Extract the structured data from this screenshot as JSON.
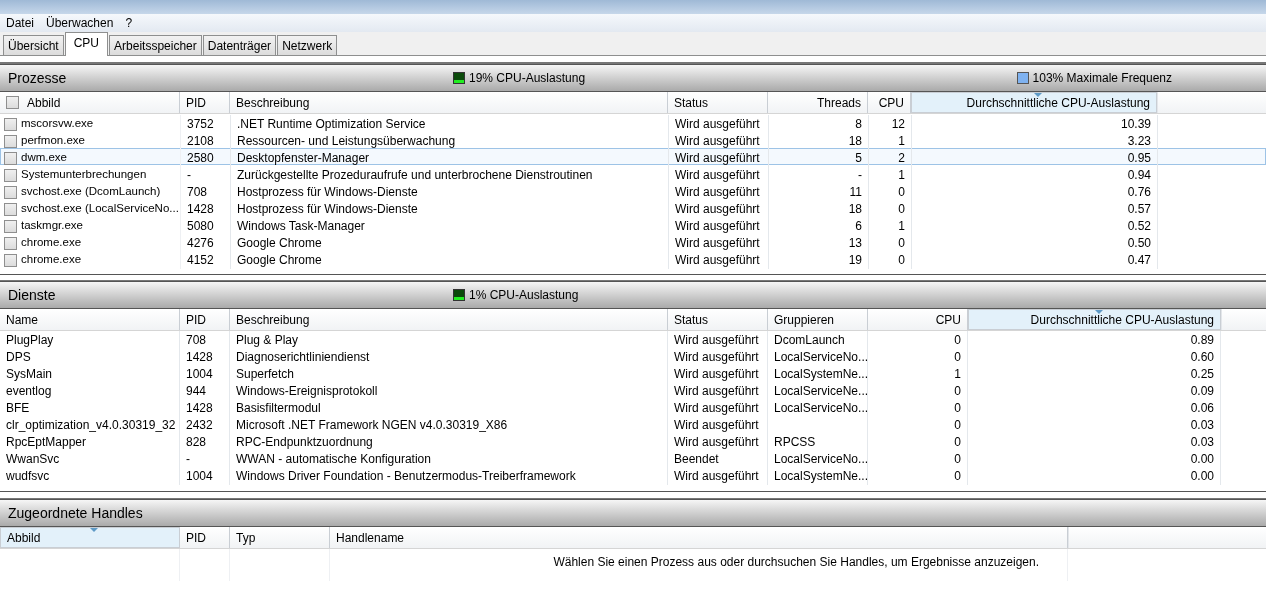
{
  "menu": [
    "Datei",
    "Überwachen",
    "?"
  ],
  "tabs": [
    {
      "label": "Übersicht",
      "selected": false
    },
    {
      "label": "CPU",
      "selected": true
    },
    {
      "label": "Arbeitsspeicher",
      "selected": false
    },
    {
      "label": "Datenträger",
      "selected": false
    },
    {
      "label": "Netzwerk",
      "selected": false
    }
  ],
  "processes": {
    "title": "Prozesse",
    "usage": "19% CPU-Auslastung",
    "frequency": "103% Maximale Frequenz",
    "header_checked": false,
    "columns": [
      {
        "label": "Abbild",
        "kind": "text",
        "sorted": false
      },
      {
        "label": "PID",
        "kind": "text",
        "sorted": false
      },
      {
        "label": "Beschreibung",
        "kind": "text",
        "sorted": false
      },
      {
        "label": "Status",
        "kind": "text",
        "sorted": false
      },
      {
        "label": "Threads",
        "kind": "number",
        "sorted": false
      },
      {
        "label": "CPU",
        "kind": "number",
        "sorted": false
      },
      {
        "label": "Durchschnittliche CPU-Auslastung",
        "kind": "number",
        "sorted": true
      }
    ],
    "rows": [
      {
        "checked": false,
        "selected": false,
        "cells": [
          "mscorsvw.exe",
          "3752",
          ".NET Runtime Optimization Service",
          "Wird ausgeführt",
          "8",
          "12",
          "10.39"
        ]
      },
      {
        "checked": false,
        "selected": false,
        "cells": [
          "perfmon.exe",
          "2108",
          "Ressourcen- und Leistungsüberwachung",
          "Wird ausgeführt",
          "18",
          "1",
          "3.23"
        ]
      },
      {
        "checked": false,
        "selected": true,
        "cells": [
          "dwm.exe",
          "2580",
          "Desktopfenster-Manager",
          "Wird ausgeführt",
          "5",
          "2",
          "0.95"
        ]
      },
      {
        "checked": false,
        "selected": false,
        "cells": [
          "Systemunterbrechungen",
          "-",
          "Zurückgestellte Prozeduraufrufe und unterbrochene Dienstroutinen",
          "Wird ausgeführt",
          "-",
          "1",
          "0.94"
        ]
      },
      {
        "checked": false,
        "selected": false,
        "cells": [
          "svchost.exe (DcomLaunch)",
          "708",
          "Hostprozess für Windows-Dienste",
          "Wird ausgeführt",
          "11",
          "0",
          "0.76"
        ]
      },
      {
        "checked": false,
        "selected": false,
        "cells": [
          "svchost.exe (LocalServiceNo...",
          "1428",
          "Hostprozess für Windows-Dienste",
          "Wird ausgeführt",
          "18",
          "0",
          "0.57"
        ]
      },
      {
        "checked": false,
        "selected": false,
        "cells": [
          "taskmgr.exe",
          "5080",
          "Windows Task-Manager",
          "Wird ausgeführt",
          "6",
          "1",
          "0.52"
        ]
      },
      {
        "checked": false,
        "selected": false,
        "cells": [
          "chrome.exe",
          "4276",
          "Google Chrome",
          "Wird ausgeführt",
          "13",
          "0",
          "0.50"
        ]
      },
      {
        "checked": false,
        "selected": false,
        "cells": [
          "chrome.exe",
          "4152",
          "Google Chrome",
          "Wird ausgeführt",
          "19",
          "0",
          "0.47"
        ]
      }
    ]
  },
  "services": {
    "title": "Dienste",
    "usage": "1% CPU-Auslastung",
    "columns": [
      {
        "label": "Name",
        "kind": "text",
        "sorted": false
      },
      {
        "label": "PID",
        "kind": "text",
        "sorted": false
      },
      {
        "label": "Beschreibung",
        "kind": "text",
        "sorted": false
      },
      {
        "label": "Status",
        "kind": "text",
        "sorted": false
      },
      {
        "label": "Gruppieren",
        "kind": "text",
        "sorted": false
      },
      {
        "label": "CPU",
        "kind": "number",
        "sorted": false
      },
      {
        "label": "Durchschnittliche CPU-Auslastung",
        "kind": "number",
        "sorted": true
      }
    ],
    "rows": [
      [
        "PlugPlay",
        "708",
        "Plug & Play",
        "Wird ausgeführt",
        "DcomLaunch",
        "0",
        "0.89"
      ],
      [
        "DPS",
        "1428",
        "Diagnoserichtliniendienst",
        "Wird ausgeführt",
        "LocalServiceNo...",
        "0",
        "0.60"
      ],
      [
        "SysMain",
        "1004",
        "Superfetch",
        "Wird ausgeführt",
        "LocalSystemNe...",
        "1",
        "0.25"
      ],
      [
        "eventlog",
        "944",
        "Windows-Ereignisprotokoll",
        "Wird ausgeführt",
        "LocalServiceNe...",
        "0",
        "0.09"
      ],
      [
        "BFE",
        "1428",
        "Basisfiltermodul",
        "Wird ausgeführt",
        "LocalServiceNo...",
        "0",
        "0.06"
      ],
      [
        "clr_optimization_v4.0.30319_32",
        "2432",
        "Microsoft .NET Framework NGEN v4.0.30319_X86",
        "Wird ausgeführt",
        "",
        "0",
        "0.03"
      ],
      [
        "RpcEptMapper",
        "828",
        "RPC-Endpunktzuordnung",
        "Wird ausgeführt",
        "RPCSS",
        "0",
        "0.03"
      ],
      [
        "WwanSvc",
        "-",
        "WWAN - automatische Konfiguration",
        "Beendet",
        "LocalServiceNo...",
        "0",
        "0.00"
      ],
      [
        "wudfsvc",
        "1004",
        "Windows Driver Foundation - Benutzermodus-Treiberframework",
        "Wird ausgeführt",
        "LocalSystemNe...",
        "0",
        "0.00"
      ]
    ]
  },
  "handles": {
    "title": "Zugeordnete Handles",
    "columns": [
      {
        "label": "Abbild",
        "sorted": true
      },
      {
        "label": "PID",
        "sorted": false
      },
      {
        "label": "Typ",
        "sorted": false
      },
      {
        "label": "Handlename",
        "sorted": false
      }
    ],
    "message": "Wählen Sie einen Prozess aus oder durchsuchen Sie Handles, um Ergebnisse anzuzeigen."
  }
}
